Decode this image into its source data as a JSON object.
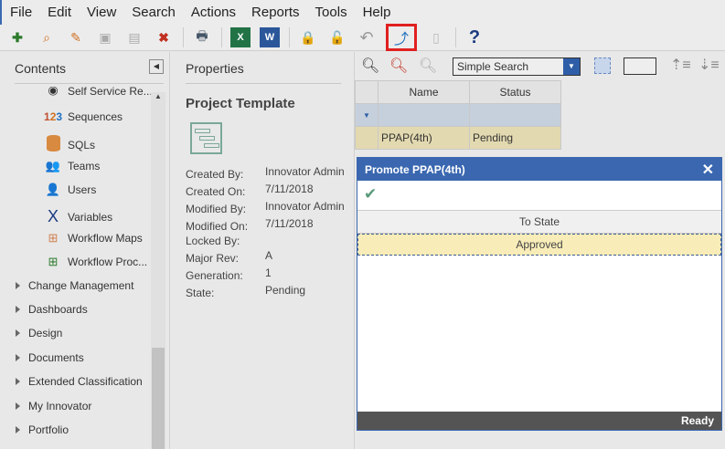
{
  "menu": [
    "File",
    "Edit",
    "View",
    "Search",
    "Actions",
    "Reports",
    "Tools",
    "Help"
  ],
  "toolbar_icons": [
    "new-item-icon",
    "search-item-icon",
    "edit-icon",
    "save-icon",
    "save-close-icon",
    "delete-icon",
    "print-icon",
    "excel-icon",
    "word-icon",
    "lock-icon",
    "unlock-icon",
    "undo-icon",
    "promote-icon",
    "paste-icon",
    "help-icon"
  ],
  "left": {
    "title": "Contents",
    "items": [
      {
        "label": "Self Service Re...",
        "icon": "report-icon"
      },
      {
        "label": "Sequences",
        "icon": "123"
      },
      {
        "label": "SQLs",
        "icon": "database-icon"
      },
      {
        "label": "Teams",
        "icon": "team-icon"
      },
      {
        "label": "Users",
        "icon": "user-icon"
      },
      {
        "label": "Variables",
        "icon": "variable-icon"
      },
      {
        "label": "Workflow Maps",
        "icon": "workflow-map-icon"
      },
      {
        "label": "Workflow Proc...",
        "icon": "workflow-process-icon"
      }
    ],
    "categories": [
      "Change Management",
      "Dashboards",
      "Design",
      "Documents",
      "Extended Classification",
      "My Innovator",
      "Portfolio"
    ]
  },
  "props": {
    "title": "Properties",
    "item_type": "Project Template",
    "rows": [
      {
        "label": "Created By:",
        "value": "Innovator Admin"
      },
      {
        "label": "Created On:",
        "value": "7/11/2018"
      },
      {
        "label": "Modified By:",
        "value": "Innovator Admin"
      },
      {
        "label": "Modified On:",
        "value": "7/11/2018"
      },
      {
        "label": "Locked By:",
        "value": ""
      },
      {
        "label": "Major Rev:",
        "value": "A"
      },
      {
        "label": "Generation:",
        "value": "1"
      },
      {
        "label": "State:",
        "value": "Pending"
      }
    ]
  },
  "grid": {
    "search_mode": "Simple Search",
    "columns": [
      "Name",
      "Status"
    ],
    "rows": [
      [
        "PPAP(4th)",
        "Pending"
      ]
    ]
  },
  "dialog": {
    "title": "Promote PPAP(4th)",
    "column": "To State",
    "rows": [
      "Approved"
    ],
    "status": "Ready"
  },
  "colors": {
    "accent": "#3a67b0",
    "highlight": "#e8dcb0",
    "selected_row": "#f8ecb8",
    "promote_box": "#e02020"
  }
}
